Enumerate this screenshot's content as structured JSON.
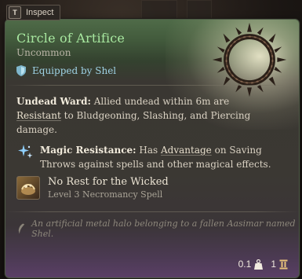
{
  "inspect": {
    "key": "T",
    "label": "Inspect"
  },
  "item": {
    "name": "Circle of Artifice",
    "rarity": "Uncommon",
    "equipped_by": "Equipped by Shel",
    "undead_ward": {
      "name": "Undead Ward:",
      "text_1": " Allied undead within 6m are ",
      "keyword": "Resistant",
      "text_2": " to Bludgeoning, Slashing, and Piercing damage."
    },
    "magic_resistance": {
      "name": "Magic Resistance:",
      "text_1": " Has ",
      "keyword": "Advantage",
      "text_2": " on Saving Throws against spells and other magical effects."
    },
    "spell": {
      "name": "No Rest for the Wicked",
      "subtitle": "Level 3 Necromancy Spell"
    },
    "flavor": "An artificial metal halo belonging to a fallen Aasimar named Shel.",
    "weight": "0.1",
    "count": "1"
  },
  "colors": {
    "title": "#a8e8a0",
    "equipped": "#9fd3e6",
    "rarity": "#b8b3a5"
  },
  "icons": {
    "inspect_key": "key-cap",
    "equipped": "shield-icon",
    "magic": "sparkle-icon",
    "spell": "spell-icon",
    "flavor": "quill-icon",
    "weight": "weight-icon",
    "count": "stack-icon"
  }
}
